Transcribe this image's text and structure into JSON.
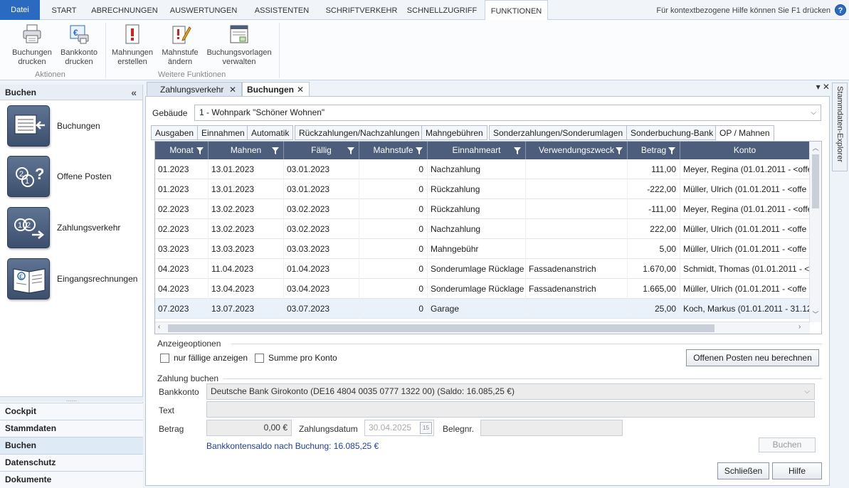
{
  "menu": {
    "file": "Datei",
    "tabs": [
      "START",
      "ABRECHNUNGEN",
      "AUSWERTUNGEN",
      "ASSISTENTEN",
      "SCHRIFTVERKEHR",
      "SCHNELLZUGRIFF",
      "FUNKTIONEN"
    ],
    "active_tab": "FUNKTIONEN",
    "help_text": "Für kontextbezogene Hilfe können Sie F1 drücken",
    "help_icon": "?"
  },
  "ribbon": {
    "aktionen_label": "Aktionen",
    "weitere_label": "Weitere Funktionen",
    "buchungen_drucken": [
      "Buchungen",
      "drucken"
    ],
    "bankkonto_drucken": [
      "Bankkonto",
      "drucken"
    ],
    "mahnungen_erstellen": [
      "Mahnungen",
      "erstellen"
    ],
    "mahnstufe_aendern": [
      "Mahnstufe",
      "ändern"
    ],
    "buchungsvorlagen_verwalten": [
      "Buchungsvorlagen",
      "verwalten"
    ]
  },
  "leftnav": {
    "title": "Buchen",
    "collapse": "«",
    "big_items": [
      "Buchungen",
      "Offene Posten",
      "Zahlungsverkehr",
      "Eingangsrechnungen"
    ],
    "divider": "......",
    "small_items": [
      "Cockpit",
      "Stammdaten",
      "Buchen",
      "Datenschutz",
      "Dokumente"
    ],
    "active_small": "Buchen"
  },
  "doctabs": {
    "tabs": [
      "Zahlungsverkehr",
      "Buchungen"
    ],
    "active": "Buchungen",
    "close": "✕",
    "controls": "▾ ✕"
  },
  "explorer": {
    "label": "Stammdaten-Explorer"
  },
  "main": {
    "gebaeude_label": "Gebäude",
    "gebaeude_value": "1 - Wohnpark \"Schöner Wohnen\"",
    "tabs": [
      "Ausgaben",
      "Einnahmen",
      "Automatik",
      "Rückzahlungen/Nachzahlungen",
      "Mahngebühren",
      "Sonderzahlungen/Sonderumlagen",
      "Sonderbuchung-Bank",
      "OP / Mahnen"
    ],
    "active_tab": "OP / Mahnen",
    "grid": {
      "columns": [
        "Monat",
        "Mahnen",
        "Fällig",
        "Mahnstufe",
        "Einnahmeart",
        "Verwendungszweck",
        "Betrag",
        "Konto"
      ],
      "rows": [
        [
          "01.2023",
          "13.01.2023",
          "03.01.2023",
          "0",
          "Nachzahlung",
          "",
          "111,00",
          "Meyer, Regina (01.01.2011 - <offe"
        ],
        [
          "01.2023",
          "13.01.2023",
          "03.01.2023",
          "0",
          "Rückzahlung",
          "",
          "-222,00",
          "Müller, Ulrich (01.01.2011 - <offe"
        ],
        [
          "02.2023",
          "13.02.2023",
          "03.02.2023",
          "0",
          "Rückzahlung",
          "",
          "-111,00",
          "Meyer, Regina (01.01.2011 - <offe"
        ],
        [
          "02.2023",
          "13.02.2023",
          "03.02.2023",
          "0",
          "Nachzahlung",
          "",
          "222,00",
          "Müller, Ulrich (01.01.2011 - <offe"
        ],
        [
          "03.2023",
          "13.03.2023",
          "03.03.2023",
          "0",
          "Mahngebühr",
          "",
          "5,00",
          "Müller, Ulrich (01.01.2011 - <offe"
        ],
        [
          "04.2023",
          "11.04.2023",
          "01.04.2023",
          "0",
          "Sonderumlage Rücklage",
          "Fassadenanstrich",
          "1.670,00",
          "Schmidt, Thomas (01.01.2011 - <("
        ],
        [
          "04.2023",
          "13.04.2023",
          "03.04.2023",
          "0",
          "Sonderumlage Rücklage",
          "Fassadenanstrich",
          "1.665,00",
          "Müller, Ulrich (01.01.2011 - <offe"
        ],
        [
          "07.2023",
          "13.07.2023",
          "03.07.2023",
          "0",
          "Garage",
          "",
          "25,00",
          "Koch, Markus (01.01.2011 - 31.12"
        ]
      ],
      "selected_row": 7
    },
    "anzeige": {
      "title": "Anzeigeoptionen",
      "nur_faellige": "nur fällige anzeigen",
      "summe_pro_konto": "Summe pro Konto",
      "recalc_button": "Offenen Posten neu berechnen"
    },
    "zahlung": {
      "title": "Zahlung buchen",
      "bankkonto_label": "Bankkonto",
      "bankkonto_value": "Deutsche Bank Girokonto (DE16 4804 0035 0777 1322 00) (Saldo: 16.085,25 €)",
      "text_label": "Text",
      "betrag_label": "Betrag",
      "betrag_value": "0,00 €",
      "zahlungsdatum_label": "Zahlungsdatum",
      "zahlungsdatum_value": "30.04.2025",
      "calendar_day": "15",
      "belegnr_label": "Belegnr.",
      "saldo_note": "Bankkontensaldo nach Buchung: 16.085,25 €",
      "buchen_button": "Buchen"
    },
    "schliessen_button": "Schließen",
    "hilfe_button": "Hilfe"
  }
}
